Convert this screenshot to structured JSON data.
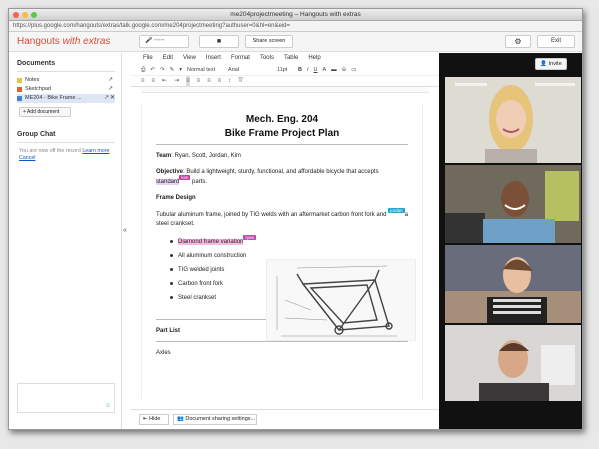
{
  "window": {
    "title": "me204projectmeeting – Hangouts with extras",
    "url": "https://plus.google.com/hangouts/extras/talk.google.com/me204projectmeeting?authuser=0&hl=en&eid="
  },
  "header": {
    "brand_main": "Hangouts ",
    "brand_italic": "with extras",
    "mic_label": "•••••",
    "share_label": "Share screen",
    "exit_label": "Exit"
  },
  "sidebar": {
    "documents_heading": "Documents",
    "items": [
      {
        "label": "Notes"
      },
      {
        "label": "Sketchpad"
      },
      {
        "label": "ME204 - Bike Frame ..."
      }
    ],
    "add_document": "+ Add document",
    "group_chat_heading": "Group Chat",
    "chat_text": "You are now off the record ",
    "learn_more": "Learn more",
    "cancel": "Cancel"
  },
  "docs": {
    "menu": [
      "File",
      "Edit",
      "View",
      "Insert",
      "Format",
      "Tools",
      "Table",
      "Help"
    ],
    "style_select": "Normal text",
    "font_select": "Arial",
    "size_select": "11pt",
    "title": "Mech. Eng. 204",
    "subtitle": "Bike Frame Project Plan",
    "team_label": "Team",
    "team_value": ": Ryan, Scott, Jordan, Kim",
    "objective_label": "Objective",
    "objective_text": ": Build a lightweight, sturdy, functional, and affordable bicycle that accepts ",
    "objective_hl": "standard",
    "objective_end": " parts.",
    "tag_kim": "kim",
    "frame_heading": "Frame Design",
    "frame_text_1": "Tubular aluminum frame, joined by TIG welds with an aftermarket carbon front fork and ",
    "frame_text_2": "a steel crankset.",
    "tag_jordan": "jordan",
    "bullets": [
      "Diamond frame variation",
      "All aluminum construction",
      "TIG welded joints",
      "Carbon front fork",
      "Steel crankset"
    ],
    "tag_ryan": "ryan",
    "part_list_heading": "Part List",
    "axles": "Axles",
    "hide_label": "Hide",
    "sharing_label": "Document sharing settings..."
  },
  "video": {
    "invite_label": "Invite"
  },
  "colors": {
    "brand_red": "#dd4b39",
    "tag_pink": "#c040a0",
    "tag_blue": "#2aa0d0",
    "tag_magenta": "#d040b0"
  }
}
